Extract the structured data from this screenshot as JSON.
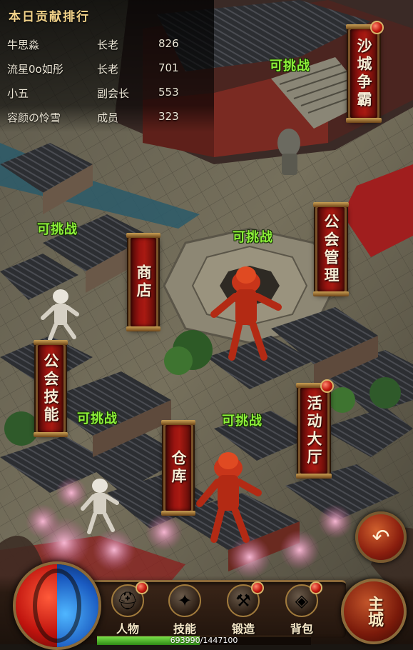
{
  "ranking": {
    "title": "本日贡献排行",
    "rows": [
      {
        "name": "牛思淼",
        "role": "长老",
        "score": "826"
      },
      {
        "name": "流星0o如彤",
        "role": "长老",
        "score": "701"
      },
      {
        "name": "小五",
        "role": "副会长",
        "score": "553"
      },
      {
        "name": "容颜の怜雪",
        "role": "成员",
        "score": "323"
      }
    ]
  },
  "plaques": {
    "sand_city": "沙城争霸",
    "guild_manage": "公会管理",
    "shop": "商店",
    "guild_skill": "公会技能",
    "warehouse": "仓库",
    "activity_hall": "活动大厅"
  },
  "challenge_label": "可挑战",
  "hud": {
    "character": "人物",
    "skills": "技能",
    "forge": "锻造",
    "bag": "背包",
    "main_city": "主城",
    "exp_text": "693990/1447100",
    "exp_fraction": 0.4796
  },
  "icons": {
    "back": "back-arrow-icon",
    "orb": "yin-yang-orb-icon"
  },
  "colors": {
    "plaque_red": "#9b1410",
    "challenge_green": "#8ef23a",
    "rank_title": "#f3d38a"
  }
}
